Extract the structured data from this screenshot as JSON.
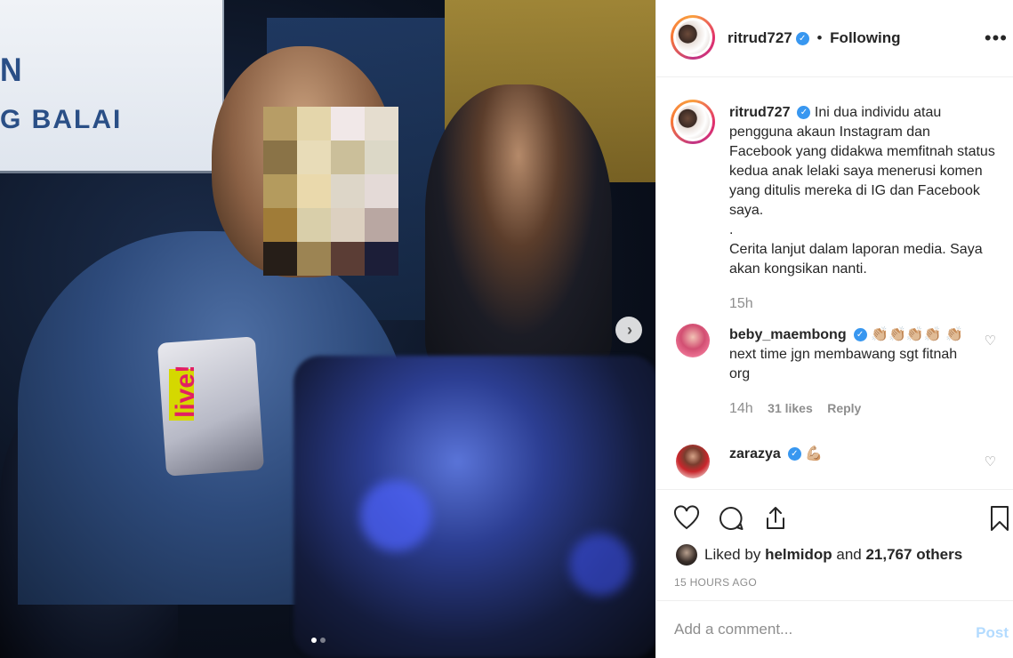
{
  "post": {
    "username": "ritrud727",
    "verified": true,
    "follow_status": "Following",
    "caption": "Ini dua individu atau pengguna akaun Instagram dan Facebook yang didakwa memfitnah status kedua anak lelaki saya menerusi komen yang ditulis mereka di IG dan Facebook saya.",
    "caption_dot": ".",
    "caption_more": "Cerita lanjut dalam laporan media. Saya akan kongsikan nanti.",
    "caption_time": "15h"
  },
  "photo": {
    "sign_text_1": "N",
    "sign_text_2": "G BALAI",
    "mic_label": "live!",
    "carousel_index": 1,
    "carousel_count": 2
  },
  "comments": [
    {
      "username": "beby_maembong",
      "verified": true,
      "text_emoji": "👏🏼👏🏼👏🏼👏🏼",
      "text": "👏🏼 next time jgn membawang sgt fitnah org",
      "time": "14h",
      "likes": "31 likes",
      "reply": "Reply"
    },
    {
      "username": "zarazya",
      "verified": true,
      "text": "💪🏼"
    }
  ],
  "likes": {
    "prefix": "Liked by",
    "user": "helmidop",
    "joiner": "and",
    "others": "21,767 others"
  },
  "timestamp": "15 HOURS AGO",
  "add_comment": {
    "placeholder": "Add a comment...",
    "post_label": "Post"
  },
  "colors": {
    "verified": "#3897f0",
    "post_disabled": "#b3dbff",
    "meta_gray": "#8e8e8e"
  },
  "icons": [
    "heart-icon",
    "comment-icon",
    "share-icon",
    "bookmark-icon",
    "more-icon",
    "chevron-right-icon"
  ]
}
